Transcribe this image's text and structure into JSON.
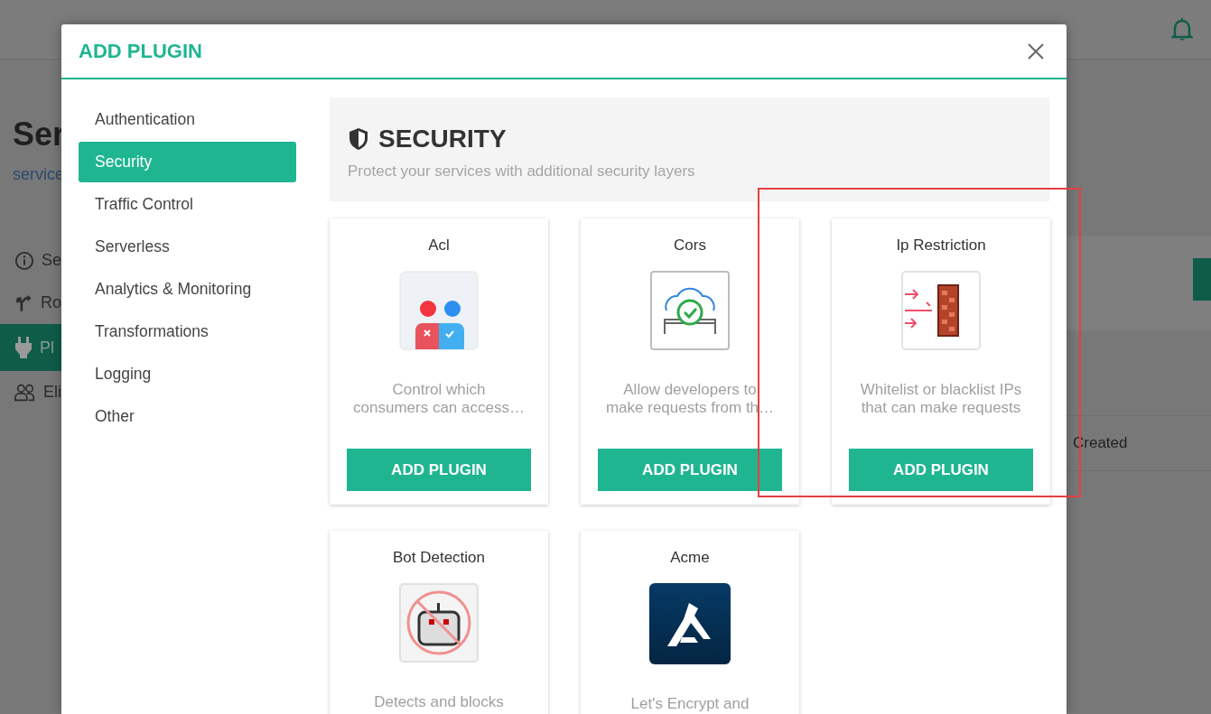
{
  "background": {
    "page_title": "Ser",
    "page_link": "service",
    "nav": [
      {
        "label": "Se",
        "kind": "info",
        "selected": false
      },
      {
        "label": "Ro",
        "kind": "routes",
        "selected": false
      },
      {
        "label": "Pl",
        "kind": "plugins",
        "selected": true
      },
      {
        "label": "Eli",
        "kind": "people",
        "selected": false
      }
    ],
    "table_column": "Created"
  },
  "dialog": {
    "title": "ADD PLUGIN",
    "categories": [
      {
        "label": "Authentication",
        "selected": false
      },
      {
        "label": "Security",
        "selected": true
      },
      {
        "label": "Traffic Control",
        "selected": false
      },
      {
        "label": "Serverless",
        "selected": false
      },
      {
        "label": "Analytics & Monitoring",
        "selected": false
      },
      {
        "label": "Transformations",
        "selected": false
      },
      {
        "label": "Logging",
        "selected": false
      },
      {
        "label": "Other",
        "selected": false
      }
    ],
    "section": {
      "title": "SECURITY",
      "subtitle": "Protect your services with additional security layers"
    },
    "plugins": [
      {
        "name": "Acl",
        "kind": "acl",
        "description": "Control which\nconsumers can access…",
        "button": "ADD PLUGIN"
      },
      {
        "name": "Cors",
        "kind": "cors",
        "description": "Allow developers to\nmake requests from th…",
        "button": "ADD PLUGIN"
      },
      {
        "name": "Ip Restriction",
        "kind": "ip",
        "description": "Whitelist or blacklist IPs\nthat can make requests",
        "button": "ADD PLUGIN"
      },
      {
        "name": "Bot Detection",
        "kind": "bot",
        "description": "Detects and blocks"
      },
      {
        "name": "Acme",
        "kind": "acme",
        "description": "Let's Encrypt and"
      }
    ]
  }
}
